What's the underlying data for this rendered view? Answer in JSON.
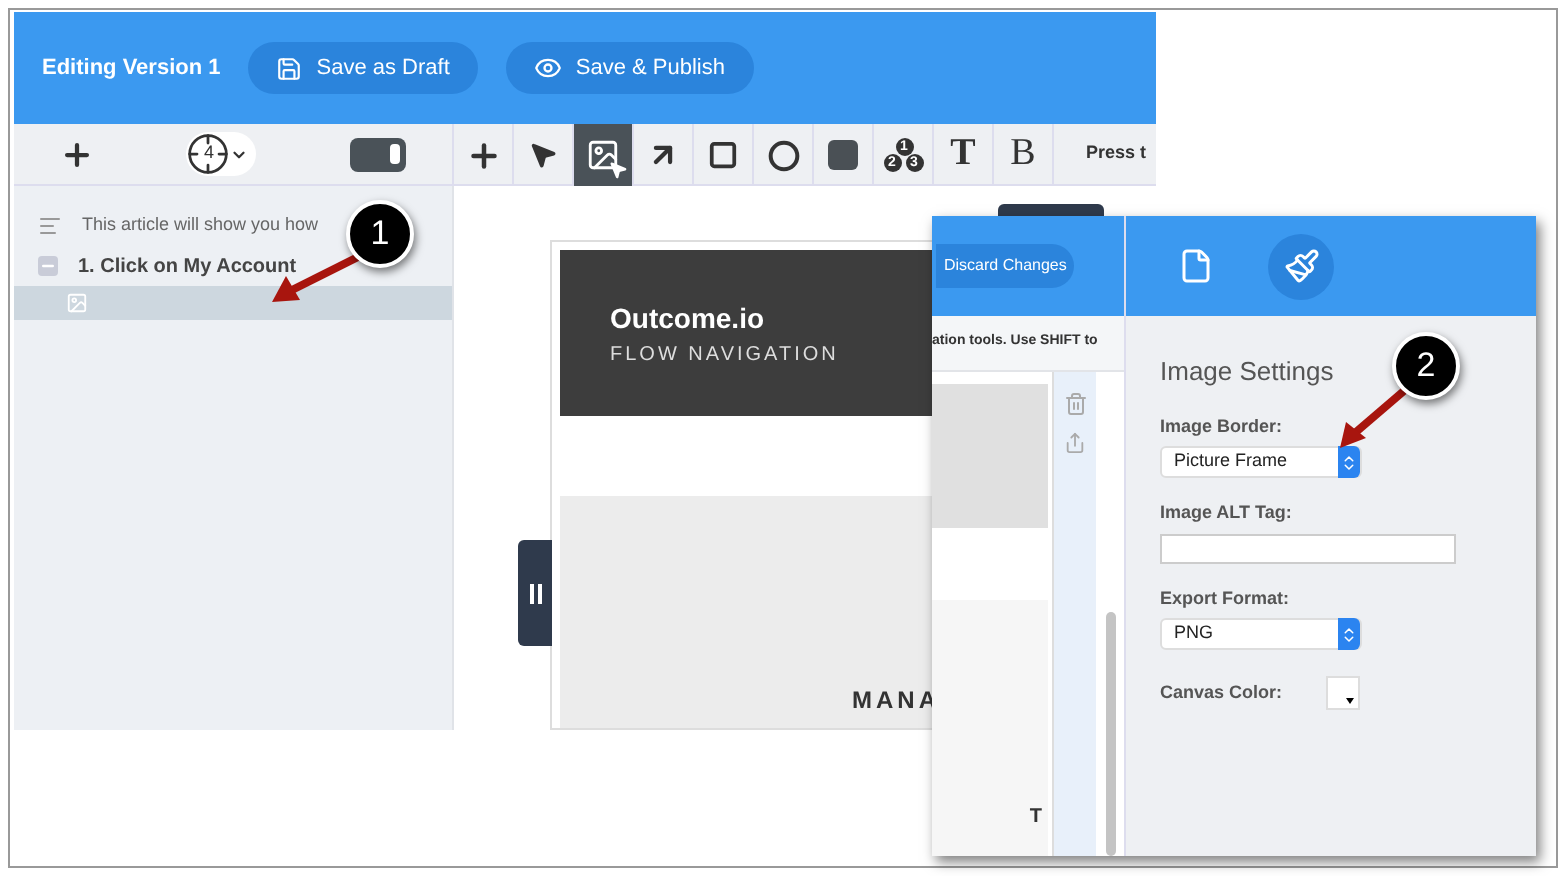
{
  "header": {
    "title": "Editing Version 1",
    "buttons": [
      {
        "kind": "save",
        "label": "Save as Draft"
      },
      {
        "kind": "eye",
        "label": "Save & Publish"
      }
    ]
  },
  "left_toolbar": {
    "step_count": "4",
    "toggle_on": true
  },
  "tools": [
    {
      "kind": "plus",
      "selected": false
    },
    {
      "kind": "pointer",
      "selected": false
    },
    {
      "kind": "image",
      "selected": true
    },
    {
      "kind": "arrow",
      "selected": false
    },
    {
      "kind": "square",
      "selected": false
    },
    {
      "kind": "circle",
      "selected": false
    },
    {
      "kind": "fill",
      "selected": false
    },
    {
      "kind": "numbers",
      "selected": false,
      "badges": [
        "1",
        "2",
        "3"
      ]
    },
    {
      "kind": "text",
      "selected": false,
      "label": "T"
    },
    {
      "kind": "bold",
      "selected": false,
      "label": "B"
    }
  ],
  "toolbar_hint": "Press t",
  "outline": [
    {
      "kind": "intro",
      "text": "This article will show you how"
    },
    {
      "kind": "step",
      "text": "1. Click on My Account",
      "expanded": true,
      "children": [
        {
          "kind": "image",
          "selected": true
        }
      ]
    }
  ],
  "preview": {
    "title": "Outcome.io",
    "subtitle": "FLOW NAVIGATION",
    "label": "MANA"
  },
  "overlay": {
    "discard": "Discard Changes",
    "hint": "ation tools. Use SHIFT to",
    "canvas_letter": "T",
    "tabs": [
      {
        "kind": "document",
        "selected": false
      },
      {
        "kind": "brush",
        "selected": true
      }
    ],
    "settings": {
      "title": "Image Settings",
      "fields": [
        {
          "kind": "select",
          "label": "Image Border:",
          "value": "Picture Frame"
        },
        {
          "kind": "text",
          "label": "Image ALT Tag:"
        },
        {
          "kind": "select",
          "label": "Export Format:",
          "value": "PNG"
        },
        {
          "kind": "color",
          "label": "Canvas Color:"
        }
      ]
    }
  },
  "callouts": [
    {
      "number": "1"
    },
    {
      "number": "2"
    }
  ]
}
